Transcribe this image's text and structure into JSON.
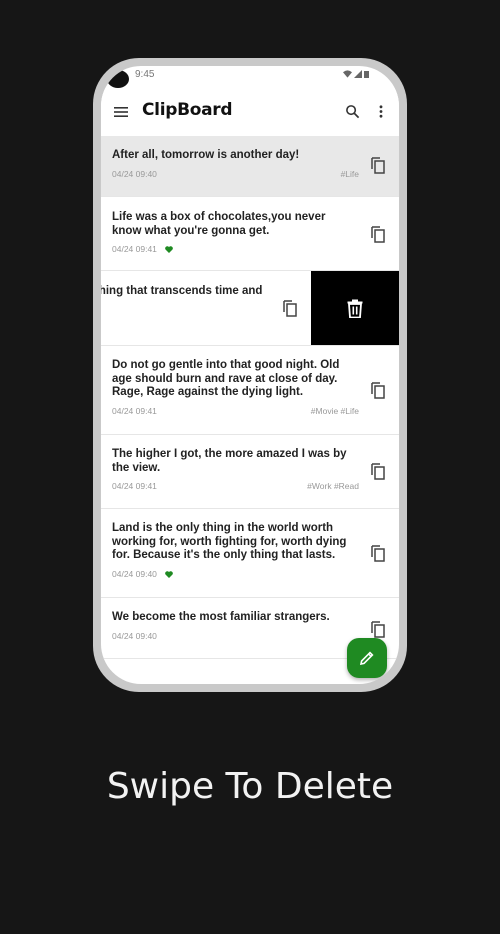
{
  "status_bar": {
    "time": "9:45"
  },
  "app_bar": {
    "title": "ClipBoard",
    "menu_icon": "hamburger-menu-icon",
    "search_icon": "search-icon",
    "more_icon": "more-vert-icon"
  },
  "clips": [
    {
      "text": "After all, tomorrow is another day!",
      "date": "04/24 09:40",
      "tags": "#Life",
      "favorite": false,
      "selected": true
    },
    {
      "text": "Life was a box of chocolates,you never know what you're gonna get.",
      "date": "04/24 09:41",
      "tags": "",
      "favorite": true
    },
    {
      "text": "thing that transcends time and",
      "date": "",
      "tags": "",
      "favorite": false,
      "swiped": true
    },
    {
      "text": "Do not go gentle into that good night. Old age should burn and rave at close of day. Rage, Rage against the dying light.",
      "date": "04/24 09:41",
      "tags": "#Movie #Life",
      "favorite": false
    },
    {
      "text": "The higher I got, the more amazed I was by the view.",
      "date": "04/24 09:41",
      "tags": "#Work #Read",
      "favorite": false
    },
    {
      "text": "Land is the only thing in the world worth working for, worth fighting for, worth dying for. Because it's the only thing that lasts.",
      "date": "04/24 09:40",
      "tags": "",
      "favorite": true
    },
    {
      "text": "We become the most familiar strangers.",
      "date": "04/24 09:40",
      "tags": "",
      "favorite": false
    }
  ],
  "colors": {
    "accent": "#1f8a22",
    "favorite": "#1f8a22",
    "delete_bg": "#000000"
  },
  "caption": "Swipe To Delete"
}
